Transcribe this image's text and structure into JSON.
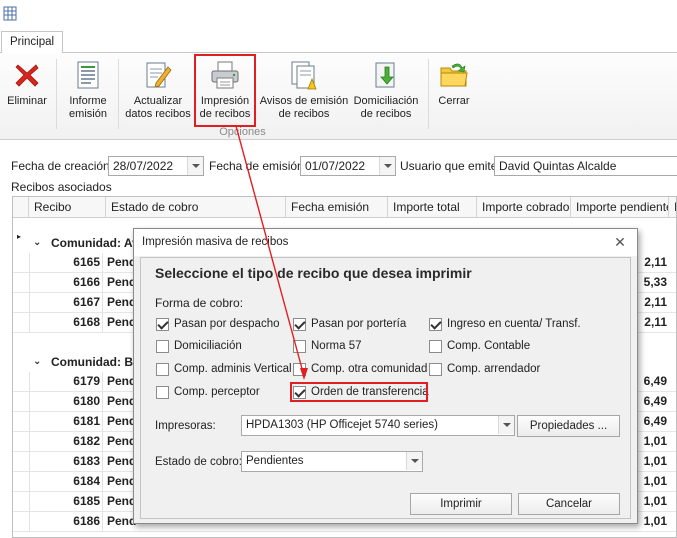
{
  "ribbon": {
    "tab": "Principal",
    "buttons": [
      {
        "label": "Eliminar",
        "icon": "delete-x-icon"
      },
      {
        "label": "Informe\nemisión",
        "icon": "report-icon"
      },
      {
        "label": "Actualizar\ndatos recibos",
        "icon": "edit-document-icon"
      },
      {
        "label": "Impresión\nde recibos",
        "icon": "printer-icon"
      },
      {
        "label": "Avisos de emisión\nde recibos",
        "icon": "notice-icon"
      },
      {
        "label": "Domiciliación\nde recibos",
        "icon": "download-document-icon"
      },
      {
        "label": "Cerrar",
        "icon": "folder-close-icon"
      }
    ],
    "group_label": "Opciones"
  },
  "form": {
    "fecha_creacion_label": "Fecha de creación:",
    "fecha_creacion": "28/07/2022",
    "fecha_emision_label": "Fecha de emisión:",
    "fecha_emision": "01/07/2022",
    "usuario_label": "Usuario que emite:",
    "usuario": "David Quintas Alcalde",
    "recibos_label": "Recibos asociados"
  },
  "grid": {
    "headers": [
      "Recibo",
      "Estado de cobro",
      "Fecha emisión",
      "Importe total",
      "Importe cobrado",
      "Importe pendiente",
      "I"
    ],
    "groups": [
      {
        "label": "Comunidad: Av",
        "rows": [
          {
            "recibo": "6165",
            "estado": "Pend",
            "pendiente": "2,11"
          },
          {
            "recibo": "6166",
            "estado": "Pend",
            "pendiente": "5,33"
          },
          {
            "recibo": "6167",
            "estado": "Pend",
            "pendiente": "2,11"
          },
          {
            "recibo": "6168",
            "estado": "Pend",
            "pendiente": "2,11"
          }
        ]
      },
      {
        "label": "Comunidad: Ba",
        "rows": [
          {
            "recibo": "6179",
            "estado": "Pend",
            "pendiente": "6,49"
          },
          {
            "recibo": "6180",
            "estado": "Pend",
            "pendiente": "6,49"
          },
          {
            "recibo": "6181",
            "estado": "Pend",
            "pendiente": "6,49"
          },
          {
            "recibo": "6182",
            "estado": "Pend",
            "pendiente": "1,01"
          },
          {
            "recibo": "6183",
            "estado": "Pend",
            "pendiente": "1,01"
          },
          {
            "recibo": "6184",
            "estado": "Pend",
            "pendiente": "1,01"
          },
          {
            "recibo": "6185",
            "estado": "Pend",
            "pendiente": "1,01"
          },
          {
            "recibo": "6186",
            "estado": "Pend",
            "pendiente": "1,01"
          }
        ]
      }
    ]
  },
  "dialog": {
    "title": "Impresión masiva de recibos",
    "heading": "Seleccione el tipo de recibo que desea imprimir",
    "forma_label": "Forma de cobro:",
    "checkboxes": [
      {
        "label": "Pasan por despacho",
        "checked": true
      },
      {
        "label": "Pasan por portería",
        "checked": true
      },
      {
        "label": "Ingreso en cuenta/ Transf.",
        "checked": true
      },
      {
        "label": "Domiciliación",
        "checked": false
      },
      {
        "label": "Norma 57",
        "checked": false
      },
      {
        "label": "Comp. Contable",
        "checked": false
      },
      {
        "label": "Comp. adminis Vertical",
        "checked": false
      },
      {
        "label": "Comp. otra comunidad",
        "checked": false
      },
      {
        "label": "Comp. arrendador",
        "checked": false
      },
      {
        "label": "Comp. perceptor",
        "checked": false
      },
      {
        "label": "Orden de transferencia",
        "checked": true
      }
    ],
    "impresoras_label": "Impresoras:",
    "impresora": "HPDA1303 (HP Officejet 5740 series)",
    "propiedades": "Propiedades ...",
    "estado_label": "Estado de cobro:",
    "estado": "Pendientes",
    "imprimir": "Imprimir",
    "cancelar": "Cancelar"
  },
  "colors": {
    "highlight": "#e02020",
    "accent_arrow": "#e02020"
  }
}
